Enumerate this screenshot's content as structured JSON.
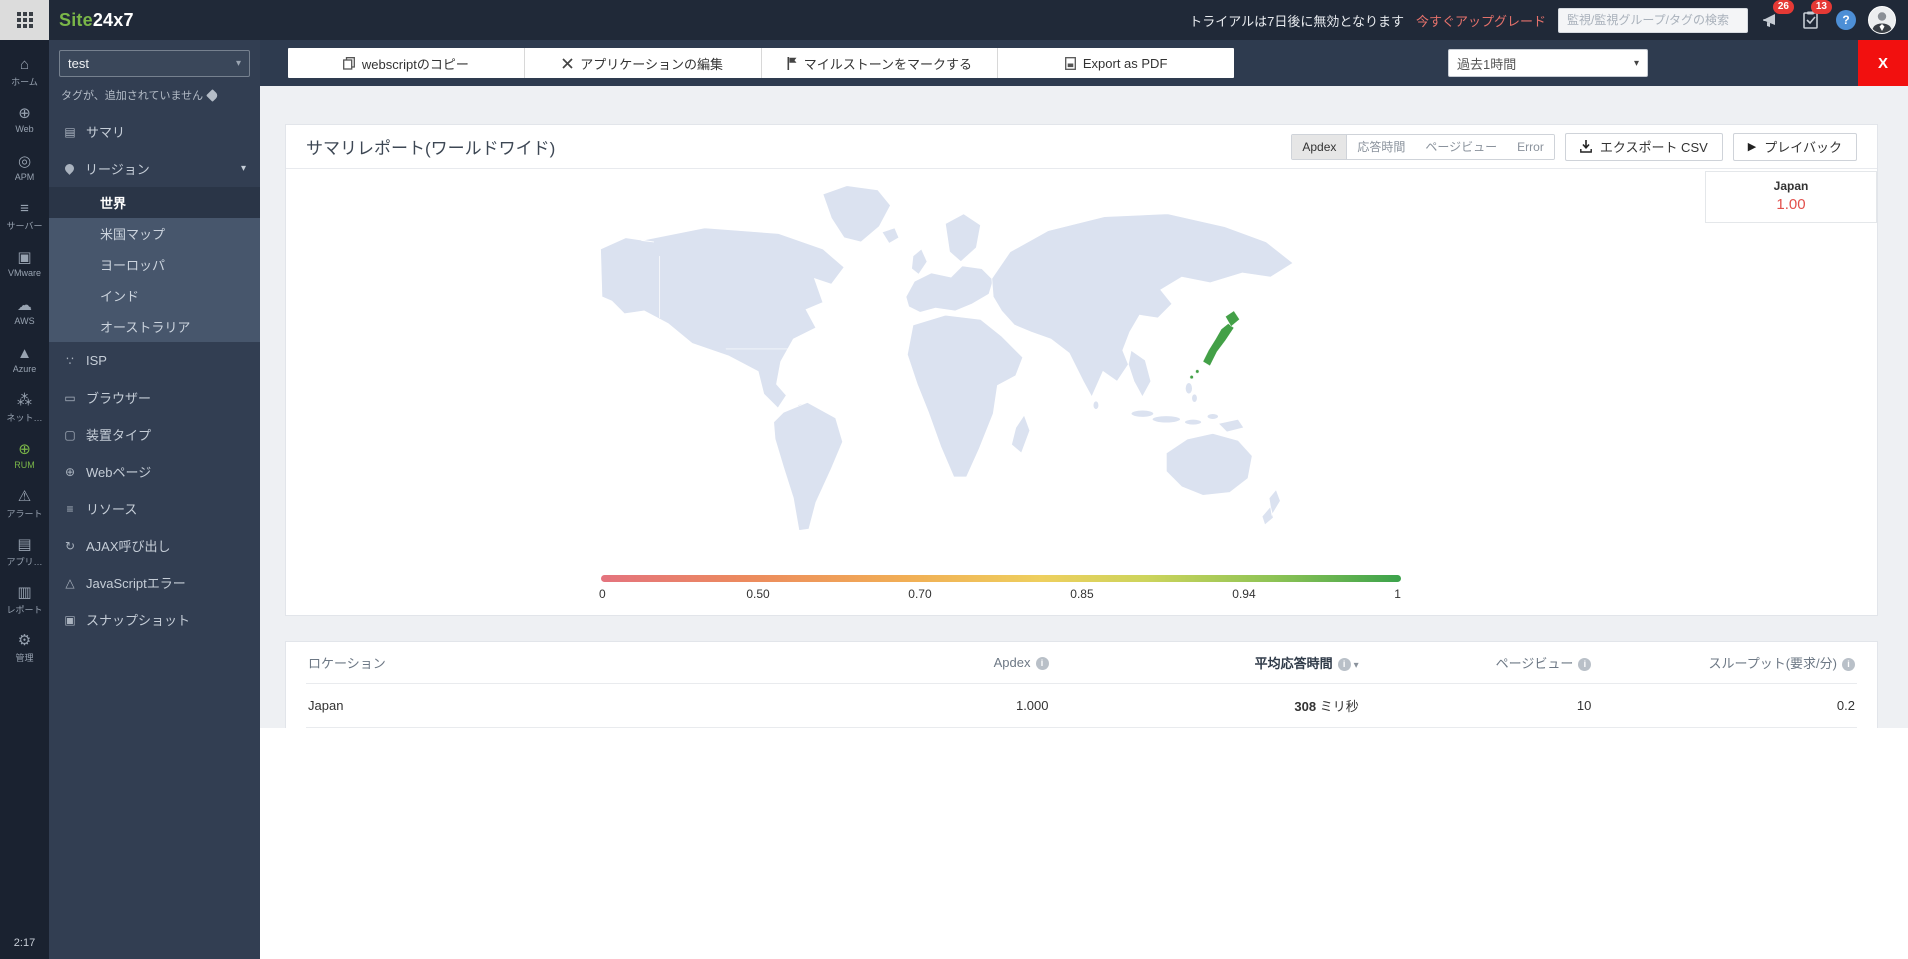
{
  "topbar": {
    "logo_site": "Site",
    "logo_rest": "24x7",
    "trial_text": "トライアルは7日後に無効となります",
    "upgrade_link": "今すぐアップグレード",
    "search_placeholder": "監視/監視グループ/タグの検索",
    "notification_badge": "26",
    "task_badge": "13",
    "help_label": "?"
  },
  "rail": {
    "items": [
      {
        "label": "ホーム",
        "icon": "home-icon",
        "glyph": "⌂"
      },
      {
        "label": "Web",
        "icon": "web-globe-icon",
        "glyph": "⊕"
      },
      {
        "label": "APM",
        "icon": "apm-binoculars-icon",
        "glyph": "◎"
      },
      {
        "label": "サーバー",
        "icon": "server-icon",
        "glyph": "≡"
      },
      {
        "label": "VMware",
        "icon": "vmware-icon",
        "glyph": "▣"
      },
      {
        "label": "AWS",
        "icon": "aws-icon",
        "glyph": "☁"
      },
      {
        "label": "Azure",
        "icon": "azure-icon",
        "glyph": "▲"
      },
      {
        "label": "ネット…",
        "icon": "network-icon",
        "glyph": "⁂"
      },
      {
        "label": "RUM",
        "icon": "rum-globe-icon",
        "glyph": "⊕"
      },
      {
        "label": "アラート",
        "icon": "alerts-icon",
        "glyph": "⚠"
      },
      {
        "label": "アプリ…",
        "icon": "app-logs-icon",
        "glyph": "▤"
      },
      {
        "label": "レポート",
        "icon": "reports-icon",
        "glyph": "▥"
      },
      {
        "label": "管理",
        "icon": "admin-gear-icon",
        "glyph": "⚙"
      }
    ],
    "session_time": "2:17"
  },
  "sidebar": {
    "monitor_name": "test",
    "tags_note": "タグが、追加されていません",
    "summary_label": "サマリ",
    "region_label": "リージョン",
    "region_children": [
      {
        "label": "世界"
      },
      {
        "label": "米国マップ"
      },
      {
        "label": "ヨーロッパ"
      },
      {
        "label": "インド"
      },
      {
        "label": "オーストラリア"
      }
    ],
    "items": [
      {
        "label": "ISP",
        "icon": "isp-icon",
        "glyph": "∵"
      },
      {
        "label": "ブラウザー",
        "icon": "browser-icon",
        "glyph": "▭"
      },
      {
        "label": "装置タイプ",
        "icon": "device-type-icon",
        "glyph": "▢"
      },
      {
        "label": "Webページ",
        "icon": "webpage-icon",
        "glyph": "⊕"
      },
      {
        "label": "リソース",
        "icon": "resources-icon",
        "glyph": "≡"
      },
      {
        "label": "AJAX呼び出し",
        "icon": "ajax-calls-icon",
        "glyph": "↻"
      },
      {
        "label": "JavaScriptエラー",
        "icon": "js-error-icon",
        "glyph": "△"
      },
      {
        "label": "スナップショット",
        "icon": "snapshot-icon",
        "glyph": "▣"
      }
    ]
  },
  "toolbar": {
    "actions": [
      {
        "label": "webscriptのコピー",
        "icon": "copy-icon"
      },
      {
        "label": "アプリケーションの編集",
        "icon": "edit-icon"
      },
      {
        "label": "マイルストーンをマークする",
        "icon": "flag-icon"
      },
      {
        "label": "Export as PDF",
        "icon": "pdf-icon"
      }
    ],
    "time_range": "過去1時間",
    "close_label": "X"
  },
  "report": {
    "title": "サマリレポート(ワールドワイド)",
    "tabs": [
      {
        "label": "Apdex"
      },
      {
        "label": "応答時間"
      },
      {
        "label": "ページビュー"
      },
      {
        "label": "Error"
      }
    ],
    "active_tab": "Apdex",
    "export_csv_label": "エクスポート CSV",
    "playback_label": "プレイバック",
    "play_glyph": "▶",
    "tooltip": {
      "location": "Japan",
      "value": "1.00"
    },
    "scale_labels": [
      "0",
      "0.50",
      "0.70",
      "0.85",
      "0.94",
      "1"
    ]
  },
  "table": {
    "headers": {
      "location": "ロケーション",
      "apdex": "Apdex",
      "avg_response": "平均応答時間",
      "page_views": "ページビュー",
      "throughput": "スループット(要求/分)"
    },
    "rows": [
      {
        "location": "Japan",
        "apdex": "1.000",
        "avg_response_value": "308",
        "avg_response_unit": "ミリ秒",
        "page_views": "10",
        "throughput": "0.2"
      }
    ]
  },
  "chart_data": {
    "type": "heatmap",
    "subtype": "world-map-apdex",
    "title": "サマリレポート(ワールドワイド)",
    "metric": "Apdex",
    "regions": [
      {
        "name": "Japan",
        "value": 1.0
      }
    ],
    "scale": {
      "min": 0,
      "max": 1,
      "ticks": [
        0,
        0.5,
        0.7,
        0.85,
        0.94,
        1
      ]
    },
    "legend_position": "bottom"
  },
  "colors": {
    "brand_green": "#7ab648",
    "upgrade_red": "#e4716b",
    "badge_red": "#e53935",
    "close_red": "#f2100f",
    "map_land": "#dbe2f0",
    "map_highlight": "#43a047",
    "tooltip_value_red": "#e2504c",
    "topbar_bg": "#202938",
    "sidebar_bg": "#323e52"
  }
}
